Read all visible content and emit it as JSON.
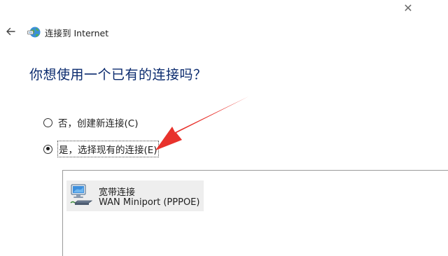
{
  "window": {
    "close_glyph": "✕",
    "title": "连接到 Internet",
    "back_icon": "arrow-left-icon",
    "app_icon": "globe-network-icon"
  },
  "page": {
    "heading": "你想使用一个已有的连接吗？"
  },
  "options": [
    {
      "label": "否，创建新连接(C)",
      "checked": false
    },
    {
      "label": "是，选择现有的连接(E)",
      "checked": true
    }
  ],
  "connections": [
    {
      "name": "宽带连接",
      "device": "WAN Miniport (PPPOE)",
      "icon": "network-connection-icon"
    }
  ],
  "annotation": {
    "color": "#e8322c"
  }
}
